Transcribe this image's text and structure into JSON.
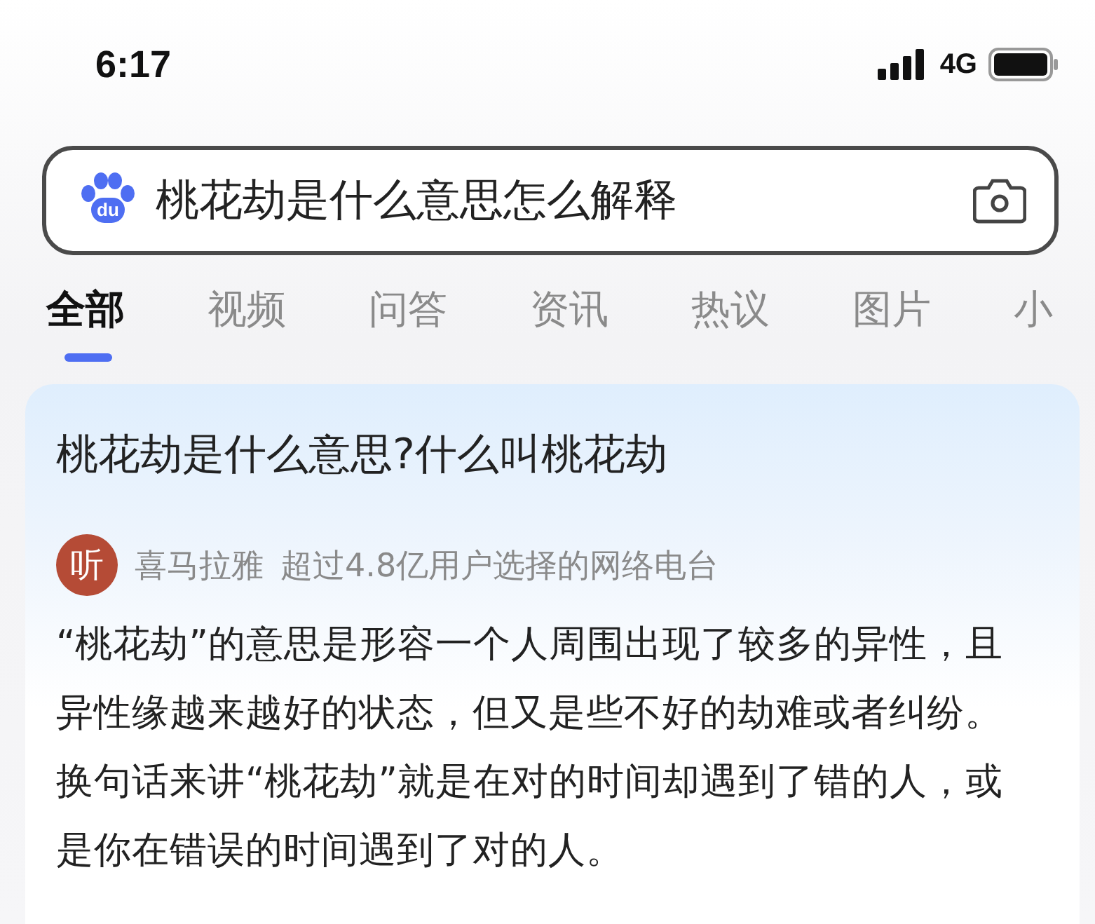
{
  "status_bar": {
    "time": "6:17",
    "network": "4G"
  },
  "search": {
    "logo_text": "du",
    "value": "桃花劫是什么意思怎么解释"
  },
  "tabs": [
    {
      "label": "全部",
      "selected": true
    },
    {
      "label": "视频",
      "selected": false
    },
    {
      "label": "问答",
      "selected": false
    },
    {
      "label": "资讯",
      "selected": false
    },
    {
      "label": "热议",
      "selected": false
    },
    {
      "label": "图片",
      "selected": false
    },
    {
      "label": "小",
      "selected": false
    }
  ],
  "result": {
    "title": "桃花劫是什么意思?什么叫桃花劫",
    "source": {
      "logo_text": "听",
      "name": "喜马拉雅",
      "tagline": "超过4.8亿用户选择的网络电台"
    },
    "snippet": "“桃花劫”的意思是形容一个人周围出现了较多的异性，且异性缘越来越好的状态，但又是些不好的劫难或者纠纷。换句话来讲“桃花劫”就是在对的时间却遇到了错的人，或是你在错误的时间遇到了对的人。"
  }
}
